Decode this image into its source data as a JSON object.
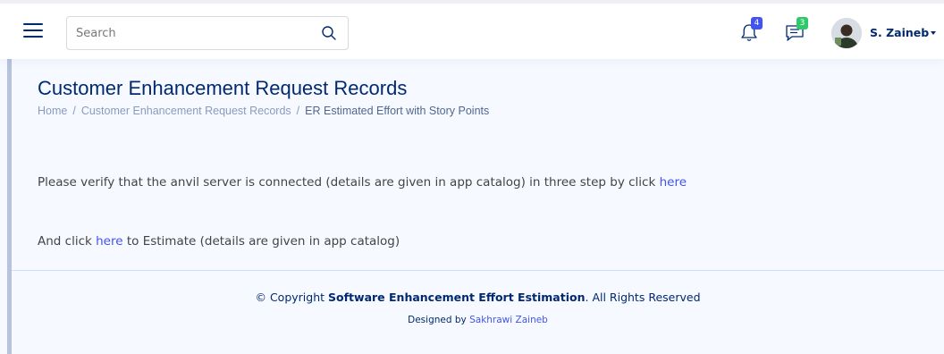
{
  "header": {
    "search": {
      "placeholder": "Search",
      "value": ""
    },
    "notifications": {
      "count": "4",
      "color": "#4154f1"
    },
    "messages": {
      "count": "3",
      "color": "#2eca6a"
    },
    "profile": {
      "name": "S. Zaineb"
    }
  },
  "page": {
    "title": "Customer Enhancement Request Records",
    "breadcrumb": {
      "home": "Home",
      "separator": "/",
      "records": "Customer Enhancement Request Records",
      "current": "ER Estimated Effort with Story Points"
    }
  },
  "content": {
    "verify_text": "Please verify that the anvil server is connected (details are given in app catalog) in three step by click",
    "verify_link": "here",
    "estimate_prefix": "And click",
    "estimate_link": "here",
    "estimate_suffix": "to Estimate (details are given in app catalog)"
  },
  "footer": {
    "copyright_prefix": "© Copyright",
    "copyright_name": "Software Enhancement Effort Estimation",
    "copyright_suffix": ". All Rights Reserved",
    "designed_by": "Designed by",
    "designer": "Sakhrawi Zaineb"
  },
  "colors": {
    "brand": "#012970",
    "accent": "#4154f1",
    "background": "#f6f9ff",
    "text": "#444444"
  },
  "icons": [
    "menu-icon",
    "search-icon",
    "bell-icon",
    "chat-icon",
    "avatar",
    "caret-down-icon"
  ]
}
